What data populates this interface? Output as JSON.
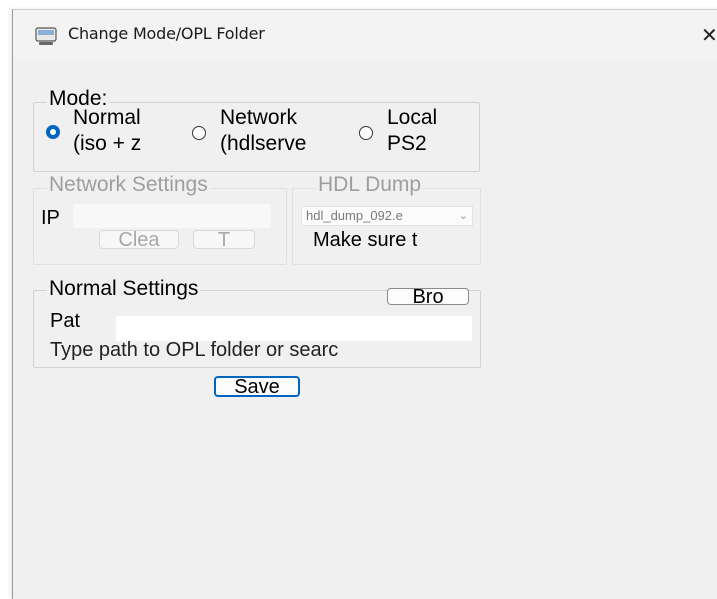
{
  "window": {
    "title": "Change Mode/OPL Folder",
    "close_glyph": "✕"
  },
  "mode": {
    "legend": "Mode:",
    "options": [
      {
        "label_line1": "Normal",
        "label_line2": "(iso + z",
        "selected": true
      },
      {
        "label_line1": "Network",
        "label_line2": "(hdlserve",
        "selected": false
      },
      {
        "label_line1": "Local",
        "label_line2": "PS2",
        "selected": false
      }
    ]
  },
  "network_settings": {
    "legend": "Network Settings",
    "ip_label": "IP",
    "ip_value": "",
    "clear_button": "Clea",
    "test_button": "T"
  },
  "hdl_dump": {
    "legend": "HDL Dump",
    "select_value": "hdl_dump_092.e",
    "note": "Make sure t"
  },
  "normal_settings": {
    "legend": "Normal Settings",
    "browse_button": "Bro",
    "path_label": "Pat",
    "path_value": "",
    "hint": "Type path to OPL folder or searc"
  },
  "save_button": "Save",
  "colors": {
    "accent": "#0067c0",
    "window_bg": "#f0f0f0",
    "disabled_text": "#9e9e9e"
  }
}
